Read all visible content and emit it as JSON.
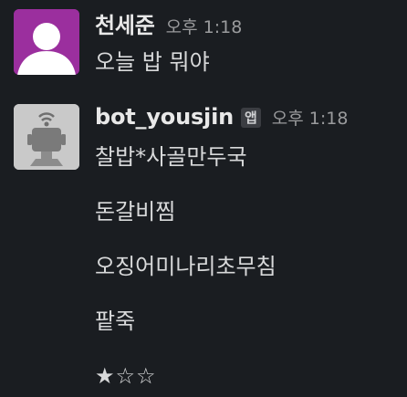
{
  "messages": [
    {
      "author": "천세준",
      "time": "오후 1:18",
      "avatar": "user-silhouette-icon",
      "avatar_color": "#9b2f9e",
      "lines": [
        "오늘 밥 뭐야"
      ]
    },
    {
      "author": "bot_yousjin",
      "badge": "앱",
      "time": "오후 1:18",
      "avatar": "robot-icon",
      "avatar_color": "#c7c7c7",
      "lines": [
        "찰밥*사골만두국",
        "돈갈비찜",
        "오징어미나리초무침",
        "팥죽",
        "★☆☆"
      ]
    }
  ],
  "colors": {
    "background": "#1a1d21",
    "text": "#d8d9da",
    "name": "#e8e8e8",
    "time": "#9a9b9d",
    "badge_bg": "#3b3d42"
  }
}
